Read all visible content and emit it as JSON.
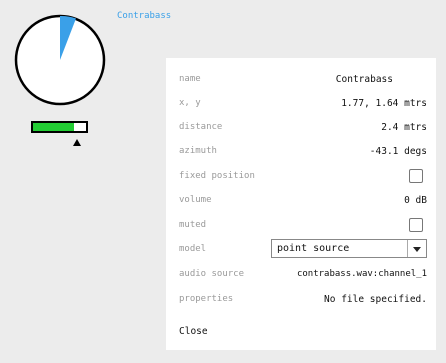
{
  "source": {
    "name_label": "Contrabass",
    "level_fraction": 0.78
  },
  "properties_panel": {
    "fields": [
      {
        "key": "name",
        "label": "name",
        "value": "Contrabass"
      },
      {
        "key": "xy",
        "label": "x, y",
        "value": "1.77, 1.64 mtrs"
      },
      {
        "key": "distance",
        "label": "distance",
        "value": "2.4 mtrs"
      },
      {
        "key": "azimuth",
        "label": "azimuth",
        "value": "-43.1 degs"
      },
      {
        "key": "fixed_position",
        "label": "fixed position",
        "checked": false
      },
      {
        "key": "volume",
        "label": "volume",
        "value": "0 dB"
      },
      {
        "key": "muted",
        "label": "muted",
        "checked": false
      },
      {
        "key": "model",
        "label": "model",
        "selected": "point source"
      },
      {
        "key": "audio_source",
        "label": "audio source",
        "value": "contrabass.wav:channel_1"
      },
      {
        "key": "properties",
        "label": "properties",
        "value": "No file specified."
      }
    ],
    "close_label": "Close"
  },
  "colors": {
    "accent": "#3aa0e8",
    "level": "#22cc33"
  }
}
